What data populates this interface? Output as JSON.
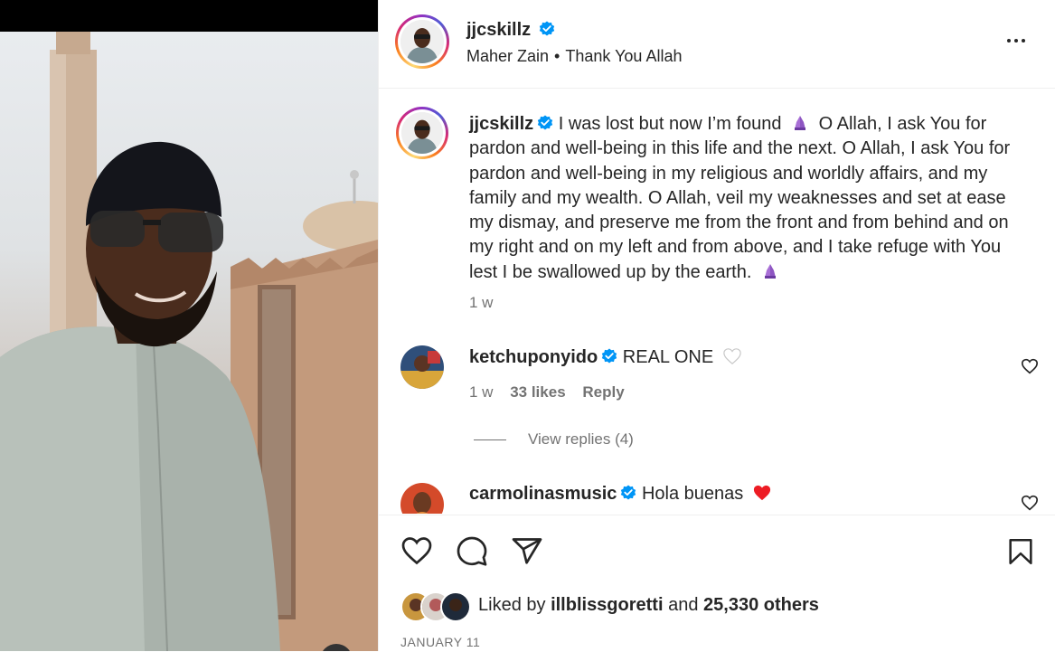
{
  "header": {
    "username": "jjcskillz",
    "verified": true,
    "music_artist": "Maher Zain",
    "music_separator": "•",
    "music_title": "Thank You Allah"
  },
  "caption": {
    "username": "jjcskillz",
    "text_part1": "I was lost but now I’m found",
    "text_part2": "O Allah, I ask You for pardon and well-being in this life and the next. O Allah, I ask You for pardon and well-being in my religious and worldly affairs, and my family and my wealth. O Allah, veil my weaknesses and set at ease my dismay, and preserve me from the front and from behind and on my right and on my left and from above, and I take refuge with You lest I be swallowed up by the earth.",
    "time": "1 w"
  },
  "comments": [
    {
      "username": "ketchuponyido",
      "verified": true,
      "text": "REAL ONE",
      "time": "1 w",
      "likes": "33 likes",
      "reply_label": "Reply",
      "view_replies": "View replies (4)"
    },
    {
      "username": "carmolinasmusic",
      "verified": true,
      "text": "Hola buenas"
    }
  ],
  "likes": {
    "prefix": "Liked by",
    "first_liker": "illblissgoretti",
    "conjunction": "and",
    "others": "25,330 others"
  },
  "date": "JANUARY 11",
  "icons": {
    "like": "heart-icon",
    "comment": "comment-icon",
    "share": "paper-plane-icon",
    "save": "bookmark-icon",
    "more": "more-options-icon",
    "verified": "verified-badge-icon"
  },
  "colors": {
    "verified": "#0095f6",
    "heart_red": "#ed4956",
    "secondary_text": "#737373"
  }
}
